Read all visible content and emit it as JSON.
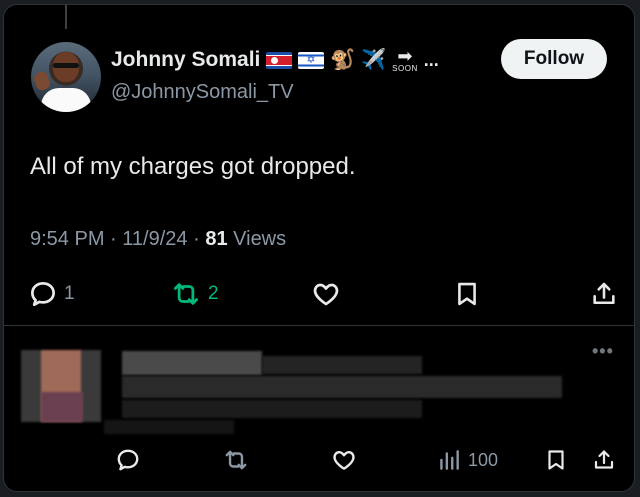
{
  "author": {
    "display_name": "Johnny Somali",
    "handle": "@JohnnySomali_TV",
    "name_emojis": [
      "🐒",
      "✈️"
    ],
    "soon_label": "SOON",
    "more_dots": "..."
  },
  "follow_label": "Follow",
  "tweet": {
    "text": "All of my charges got dropped.",
    "time": "9:54 PM",
    "date": "11/9/24",
    "views_count": "81",
    "views_label": "Views",
    "separator": "·"
  },
  "actions": {
    "replies": "1",
    "reposts": "2",
    "reply_icon": "reply-icon",
    "repost_icon": "repost-icon",
    "like_icon": "heart-icon",
    "bookmark_icon": "bookmark-icon",
    "share_icon": "share-icon"
  },
  "reply": {
    "more": "•••",
    "views": "100"
  },
  "colors": {
    "background": "#000000",
    "text": "#e7e9ea",
    "muted": "#8b98a5",
    "repost_green": "#00ba7c",
    "follow_bg": "#eff3f4"
  }
}
